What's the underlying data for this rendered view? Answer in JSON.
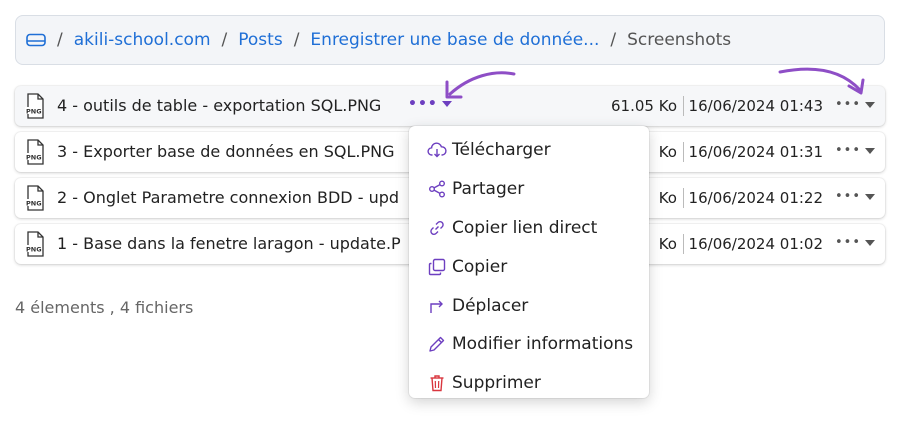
{
  "breadcrumb": {
    "root": "akili-school.com",
    "posts": "Posts",
    "post": "Enregistrer une base de donnée...",
    "current": "Screenshots",
    "separator": "/"
  },
  "files": [
    {
      "icon_label": "PNG",
      "name": "4 - outils de table - exportation SQL.PNG",
      "size": "61.05 Ko",
      "date": "16/06/2024 01:43"
    },
    {
      "icon_label": "PNG",
      "name": "3 - Exporter base de données en SQL.PNG",
      "size": "Ko",
      "date": "16/06/2024 01:31"
    },
    {
      "icon_label": "PNG",
      "name": "2 - Onglet Parametre connexion BDD - upd",
      "size": "Ko",
      "date": "16/06/2024 01:22"
    },
    {
      "icon_label": "PNG",
      "name": "1 - Base dans la fenetre laragon - update.P",
      "size": "Ko",
      "date": "16/06/2024 01:02"
    }
  ],
  "row_menu_glyph": "•••",
  "actions_glyph": "•••",
  "summary": "4 élements , 4 fichiers",
  "context_menu": {
    "items": [
      {
        "label": "Télécharger",
        "icon": "download-cloud-icon"
      },
      {
        "label": "Partager",
        "icon": "share-icon"
      },
      {
        "label": "Copier lien direct",
        "icon": "link-icon"
      },
      {
        "label": "Copier",
        "icon": "copy-icon"
      },
      {
        "label": "Déplacer",
        "icon": "move-arrow-icon"
      },
      {
        "label": "Modifier informations",
        "icon": "pencil-icon"
      },
      {
        "label": "Supprimer",
        "icon": "trash-icon"
      }
    ]
  },
  "colors": {
    "link": "#1f6fd6",
    "accent": "#6d3fc0",
    "annotation": "#8e4ec6",
    "danger": "#d9363e"
  }
}
